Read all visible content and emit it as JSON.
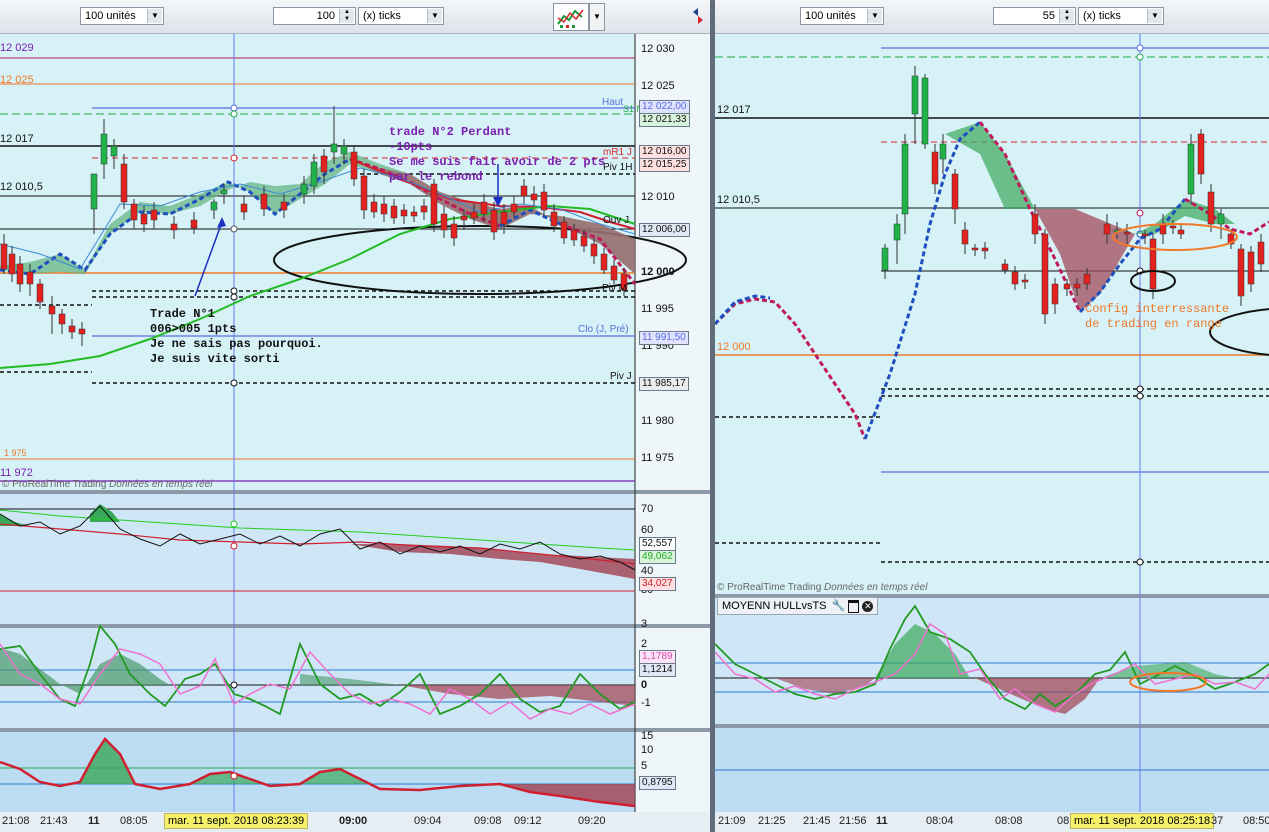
{
  "left": {
    "units_select": "100 unités",
    "ticks_value": "100",
    "ticks_select": "(x) ticks",
    "price_axis": [
      "12 030",
      "12 025",
      "12 010",
      "12 000",
      "11 995",
      "11 990",
      "11 980",
      "11 975"
    ],
    "price_boxes": {
      "haut": "12 022,00",
      "green_dash": "12 021,33",
      "mr1": "12 016,00",
      "mr1b": "12 015,25",
      "ouv": "12 006,00",
      "clo": "11 991,50",
      "pivj": "11 985,17"
    },
    "levels_left": [
      "12 029",
      "12 025",
      "12 017",
      "12 010,5",
      "1 975",
      "11 972"
    ],
    "line_labels": {
      "haut": "Haut",
      "s1": "S1 M",
      "mr1": "mR1 J",
      "piv1h": "Piv 1H",
      "ouv": "Ouv J",
      "pivm": "Piv M",
      "clo": "Clo (J, Pré)",
      "pivj": "Piv J"
    },
    "notes": {
      "trade1": "Trade N°1\n006>005 1pts\nJe ne sais pas pourquoi.\nJe suis vite sorti",
      "trade2": "trade N°2 Perdant\n-10pts\nSe me suis fait avoir de 2 pts\npar le rebond"
    },
    "credit_brand": "© ProRealTime Trading",
    "credit_text": "Données en temps réel",
    "ind1_axis": [
      "70",
      "60",
      "40",
      "30"
    ],
    "ind1_boxes": [
      "52,557",
      "49,062",
      "34,027"
    ],
    "ind2_axis": [
      "3",
      "2",
      "1",
      "0",
      "-1"
    ],
    "ind2_boxes": [
      "1,1789",
      "1,1214"
    ],
    "ind3_axis": [
      "15",
      "10",
      "5"
    ],
    "ind3_box": "0,8795",
    "time_labels": [
      "21:08",
      "21:43",
      "11",
      "08:05",
      "09:00",
      "09:04",
      "09:08",
      "09:12",
      "09:20"
    ],
    "cursor_date": "mar. 11 sept. 2018 08:23:39"
  },
  "right": {
    "units_select": "100 unités",
    "ticks_value": "55",
    "ticks_select": "(x) ticks",
    "levels": [
      "12 017",
      "12 010,5",
      "12 000"
    ],
    "note": "Config interressante\nde trading en range",
    "credit_brand": "© ProRealTime Trading",
    "credit_text": "Données en temps réel",
    "indicator_title": "MOYENN HULLvsTS",
    "time_labels": [
      "21:09",
      "21:25",
      "21:45",
      "21:56",
      "11",
      "08:04",
      "08:08",
      "08",
      "37",
      "08:50"
    ],
    "cursor_date": "mar. 11 sept. 2018 08:25:18"
  },
  "colors": {
    "bg_main": "#d7f3f8",
    "bg_ind": "#c9e6f7",
    "up": "#21b24a",
    "down": "#e3211f",
    "hull_up": "#1f4fbf",
    "hull_down": "#c0185b",
    "note_purple": "#7a1fb0",
    "note_orange": "#f07828",
    "cursor_date_bg": "#f5f06a"
  }
}
